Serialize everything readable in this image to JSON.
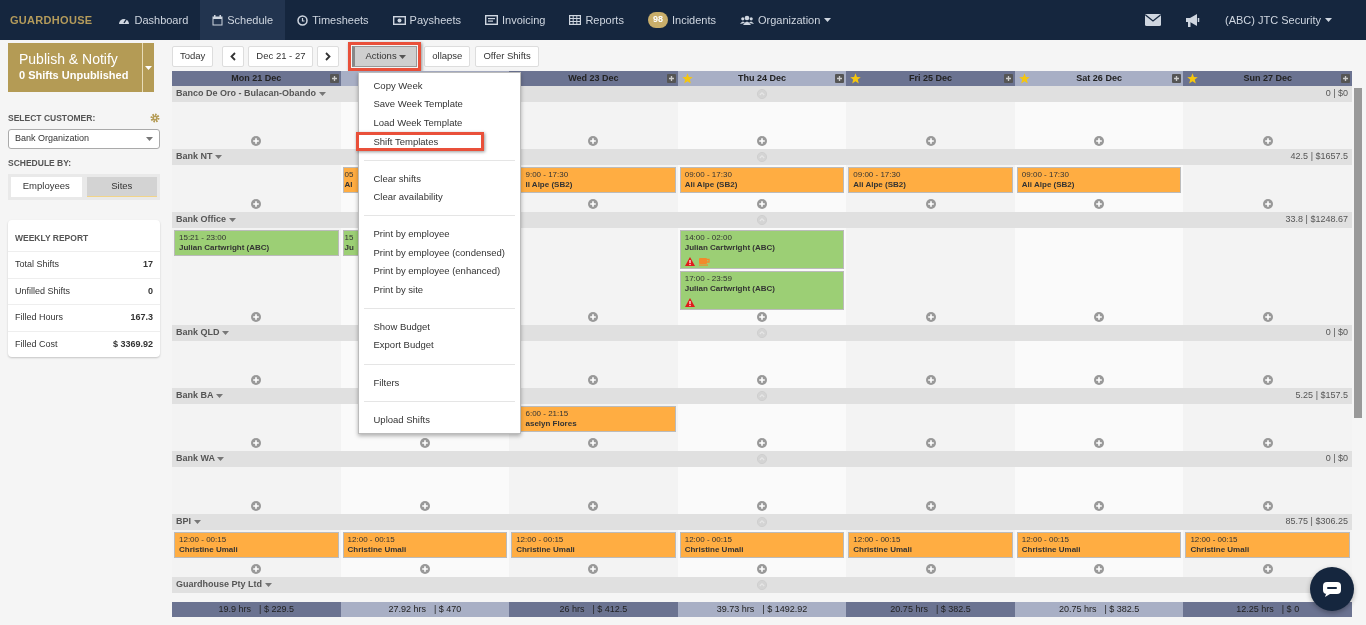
{
  "navbar": {
    "brand": "GUARDHOUSE",
    "items": [
      {
        "label": "Dashboard",
        "selected": false
      },
      {
        "label": "Schedule",
        "selected": true
      },
      {
        "label": "Timesheets",
        "selected": false
      },
      {
        "label": "Paysheets",
        "selected": false
      },
      {
        "label": "Invoicing",
        "selected": false
      },
      {
        "label": "Reports",
        "selected": false
      },
      {
        "label": "Incidents",
        "badge": "98",
        "selected": false
      },
      {
        "label": "Organization",
        "selected": false
      }
    ],
    "account": "(ABC) JTC Security"
  },
  "sidebar": {
    "publish": {
      "title": "Publish & Notify",
      "subtitle": "0 Shifts Unpublished"
    },
    "customer_label": "SELECT CUSTOMER:",
    "customer": "Bank Organization",
    "schedule_by_label": "SCHEDULE BY:",
    "schedule_by": [
      {
        "label": "Employees",
        "selected": false
      },
      {
        "label": "Sites",
        "selected": true
      }
    ],
    "report": {
      "title": "WEEKLY REPORT",
      "rows": [
        {
          "label": "Total Shifts",
          "value": "17"
        },
        {
          "label": "Unfilled Shifts",
          "value": "0"
        },
        {
          "label": "Filled Hours",
          "value": "167.3"
        },
        {
          "label": "Filled Cost",
          "value": "$ 3369.92"
        }
      ]
    }
  },
  "toolbar": {
    "today": "Today",
    "range": "Dec 21 - 27",
    "actions": "Actions",
    "collapse": "ollapse",
    "offer": "Offer Shifts"
  },
  "actions_menu": [
    [
      {
        "label": "Copy Week",
        "highlighted": false
      },
      {
        "label": "Save Week Template",
        "highlighted": false
      },
      {
        "label": "Load Week Template",
        "highlighted": false
      },
      {
        "label": "Shift Templates",
        "highlighted": true
      }
    ],
    [
      {
        "label": "Clear shifts",
        "highlighted": false
      },
      {
        "label": "Clear availability",
        "highlighted": false
      }
    ],
    [
      {
        "label": "Print by employee",
        "highlighted": false
      },
      {
        "label": "Print by employee (condensed)",
        "highlighted": false
      },
      {
        "label": "Print by employee (enhanced)",
        "highlighted": false
      },
      {
        "label": "Print by site",
        "highlighted": false
      }
    ],
    [
      {
        "label": "Show Budget",
        "highlighted": false
      },
      {
        "label": "Export Budget",
        "highlighted": false
      }
    ],
    [
      {
        "label": "Filters",
        "highlighted": false
      }
    ],
    [
      {
        "label": "Upload Shifts",
        "highlighted": false
      }
    ]
  ],
  "days": [
    {
      "label": "Mon 21 Dec",
      "expand_button": true
    },
    {
      "expand_button": false
    },
    {
      "label": "Wed 23 Dec",
      "expand_button": true
    },
    {
      "label": "Thu 24 Dec",
      "starred": true,
      "expand_button": true
    },
    {
      "label": "Fri 25 Dec",
      "starred": true,
      "expand_button": true
    },
    {
      "label": "Sat 26 Dec",
      "starred": true,
      "expand_button": true
    },
    {
      "label": "Sun 27 Dec",
      "starred": true,
      "expand_button": true
    }
  ],
  "sites": [
    {
      "name": "Banco De Oro - Bulacan-Obando",
      "total": "0 | $0",
      "days": [
        {
          "add_button": true
        },
        {
          "add_button": false
        },
        {
          "add_button": true
        },
        {
          "add_button": true
        },
        {
          "add_button": true
        },
        {
          "add_button": true
        },
        {
          "add_button": true
        }
      ]
    },
    {
      "name": "Bank NT",
      "total": "42.5 | $1657.5",
      "days": [
        {
          "add_button": true
        },
        {
          "add_button": false,
          "shifts": [
            {
              "time": "05",
              "name": "Al",
              "color": "#ffad42"
            }
          ]
        },
        {
          "add_button": true,
          "shifts": [
            {
              "time": "9:00 - 17:30",
              "name": "ll Alpe (SB2)",
              "color": "#ffad42"
            }
          ]
        },
        {
          "add_button": true,
          "shifts": [
            {
              "time": "09:00 - 17:30",
              "name": "Ali Alpe (SB2)",
              "color": "#ffad42"
            }
          ]
        },
        {
          "add_button": true,
          "shifts": [
            {
              "time": "09:00 - 17:30",
              "name": "Ali Alpe (SB2)",
              "color": "#ffad42"
            }
          ]
        },
        {
          "add_button": true,
          "shifts": [
            {
              "time": "09:00 - 17:30",
              "name": "Ali Alpe (SB2)",
              "color": "#ffad42"
            }
          ]
        },
        {
          "add_button": true
        }
      ]
    },
    {
      "name": "Bank Office",
      "total": "33.8 | $1248.67",
      "days": [
        {
          "add_button": true,
          "shifts": [
            {
              "time": "15:21 - 23:00",
              "name": "Julian Cartwright (ABC)",
              "color": "#9ccf75"
            }
          ]
        },
        {
          "add_button": false,
          "shifts": [
            {
              "time": "15",
              "name": "Ju",
              "color": "#9ccf75"
            }
          ]
        },
        {
          "add_button": true
        },
        {
          "add_button": true,
          "shifts": [
            {
              "time": "14:00 - 02:00",
              "name": "Julian Cartwright (ABC)",
              "color": "#9ccf75",
              "warning": true,
              "break": true
            },
            {
              "time": "17:00 - 23:59",
              "name": "Julian Cartwright (ABC)",
              "color": "#9ccf75",
              "warning": true
            }
          ]
        },
        {
          "add_button": true
        },
        {
          "add_button": true
        },
        {
          "add_button": true
        }
      ]
    },
    {
      "name": "Bank QLD",
      "total": "0 | $0",
      "days": [
        {
          "add_button": true
        },
        {
          "add_button": false
        },
        {
          "add_button": true
        },
        {
          "add_button": true
        },
        {
          "add_button": true
        },
        {
          "add_button": true
        },
        {
          "add_button": true
        }
      ]
    },
    {
      "name": "Bank BA",
      "total": "5.25 | $157.5",
      "days": [
        {
          "add_button": true
        },
        {
          "add_button": true
        },
        {
          "add_button": true,
          "shifts": [
            {
              "time": "6:00 - 21:15",
              "name": "aselyn Flores",
              "color": "#ffad42"
            }
          ]
        },
        {
          "add_button": true
        },
        {
          "add_button": true
        },
        {
          "add_button": true
        },
        {
          "add_button": true
        }
      ]
    },
    {
      "name": "Bank WA",
      "total": "0 | $0",
      "days": [
        {
          "add_button": true
        },
        {
          "add_button": true
        },
        {
          "add_button": true
        },
        {
          "add_button": true
        },
        {
          "add_button": true
        },
        {
          "add_button": true
        },
        {
          "add_button": true
        }
      ]
    },
    {
      "name": "BPI",
      "total": "85.75 | $306.25",
      "days": [
        {
          "add_button": true,
          "shifts": [
            {
              "time": "12:00 - 00:15",
              "name": "Christine Umali",
              "color": "#ffad42"
            }
          ]
        },
        {
          "add_button": true,
          "shifts": [
            {
              "time": "12:00 - 00:15",
              "name": "Christine Umali",
              "color": "#ffad42"
            }
          ]
        },
        {
          "add_button": true,
          "shifts": [
            {
              "time": "12:00 - 00:15",
              "name": "Christine Umali",
              "color": "#ffad42"
            }
          ]
        },
        {
          "add_button": true,
          "shifts": [
            {
              "time": "12:00 - 00:15",
              "name": "Christine Umali",
              "color": "#ffad42"
            }
          ]
        },
        {
          "add_button": true,
          "shifts": [
            {
              "time": "12:00 - 00:15",
              "name": "Christine Umali",
              "color": "#ffad42"
            }
          ]
        },
        {
          "add_button": true,
          "shifts": [
            {
              "time": "12:00 - 00:15",
              "name": "Christine Umali",
              "color": "#ffad42"
            }
          ]
        },
        {
          "add_button": true,
          "shifts": [
            {
              "time": "12:00 - 00:15",
              "name": "Christine Umali",
              "color": "#ffad42"
            }
          ]
        }
      ]
    },
    {
      "name": "Guardhouse Pty Ltd"
    }
  ],
  "totals": [
    {
      "hours": "19.9 hrs",
      "cost": "| $ 229.5"
    },
    {
      "hours": "27.92 hrs",
      "cost": "| $ 470"
    },
    {
      "hours": "26 hrs",
      "cost": "| $ 412.5"
    },
    {
      "hours": "39.73 hrs",
      "cost": "| $ 1492.92"
    },
    {
      "hours": "20.75 hrs",
      "cost": "| $ 382.5"
    },
    {
      "hours": "20.75 hrs",
      "cost": "| $ 382.5"
    },
    {
      "hours": "12.25 hrs",
      "cost": "| $ 0"
    }
  ]
}
